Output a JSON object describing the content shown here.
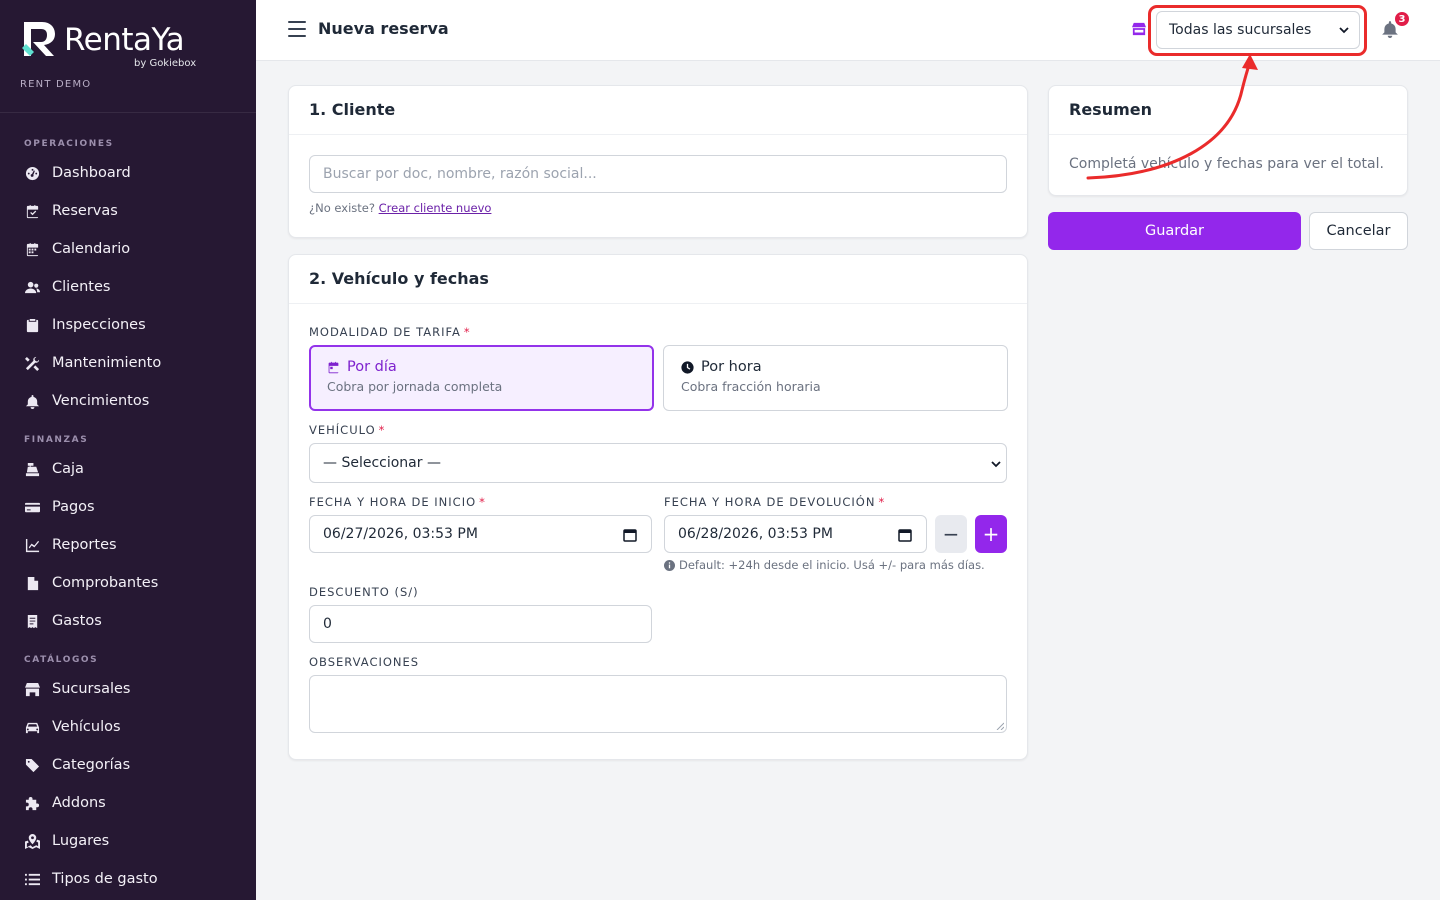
{
  "brand": {
    "name": "RentaYa",
    "byline": "by Gokiebox",
    "tenant": "RENT DEMO"
  },
  "sidebar": {
    "sections": [
      {
        "title": "OPERACIONES",
        "items": [
          {
            "label": "Dashboard",
            "icon": "dashboard-icon"
          },
          {
            "label": "Reservas",
            "icon": "calendar-check-icon"
          },
          {
            "label": "Calendario",
            "icon": "calendar-icon"
          },
          {
            "label": "Clientes",
            "icon": "users-icon"
          },
          {
            "label": "Inspecciones",
            "icon": "clipboard-check-icon"
          },
          {
            "label": "Mantenimiento",
            "icon": "tools-icon"
          },
          {
            "label": "Vencimientos",
            "icon": "bell-icon"
          }
        ]
      },
      {
        "title": "FINANZAS",
        "items": [
          {
            "label": "Caja",
            "icon": "cash-register-icon"
          },
          {
            "label": "Pagos",
            "icon": "credit-card-icon"
          },
          {
            "label": "Reportes",
            "icon": "chart-line-icon"
          },
          {
            "label": "Comprobantes",
            "icon": "invoice-icon"
          },
          {
            "label": "Gastos",
            "icon": "receipt-icon"
          }
        ]
      },
      {
        "title": "CATÁLOGOS",
        "items": [
          {
            "label": "Sucursales",
            "icon": "store-icon"
          },
          {
            "label": "Vehículos",
            "icon": "car-icon"
          },
          {
            "label": "Categorías",
            "icon": "tags-icon"
          },
          {
            "label": "Addons",
            "icon": "puzzle-icon"
          },
          {
            "label": "Lugares",
            "icon": "map-marked-icon"
          },
          {
            "label": "Tipos de gasto",
            "icon": "list-icon"
          }
        ]
      }
    ]
  },
  "header": {
    "title": "Nueva reserva",
    "branch_select": "Todas las sucursales",
    "notification_count": "3"
  },
  "client_card": {
    "title": "1. Cliente",
    "search_placeholder": "Buscar por doc, nombre, razón social...",
    "missing_text": "¿No existe?",
    "create_link": "Crear cliente nuevo"
  },
  "vehicle_card": {
    "title": "2. Vehículo y fechas",
    "rate_label": "MODALIDAD DE TARIFA",
    "rate_options": [
      {
        "title": "Por día",
        "desc": "Cobra por jornada completa",
        "selected": true
      },
      {
        "title": "Por hora",
        "desc": "Cobra fracción horaria",
        "selected": false
      }
    ],
    "vehicle_label": "VEHÍCULO",
    "vehicle_value": "— Seleccionar —",
    "start_label": "FECHA Y HORA DE INICIO",
    "start_value": "06/27/2026, 03:53 PM",
    "return_label": "FECHA Y HORA DE DEVOLUCIÓN",
    "return_value": "06/28/2026, 03:53 PM",
    "return_hint": "Default: +24h desde el inicio. Usá +/- para más días.",
    "minus": "−",
    "plus": "+",
    "discount_label": "DESCUENTO (S/)",
    "discount_value": "0",
    "notes_label": "OBSERVACIONES",
    "notes_value": "",
    "required_mark": "*"
  },
  "summary_card": {
    "title": "Resumen",
    "text": "Completá vehículo y fechas para ver el total."
  },
  "actions": {
    "save": "Guardar",
    "cancel": "Cancelar"
  },
  "colors": {
    "sidebar_bg": "#261833",
    "accent": "#9327eb",
    "highlight": "#ea2b2b",
    "badge": "#e11d48"
  }
}
